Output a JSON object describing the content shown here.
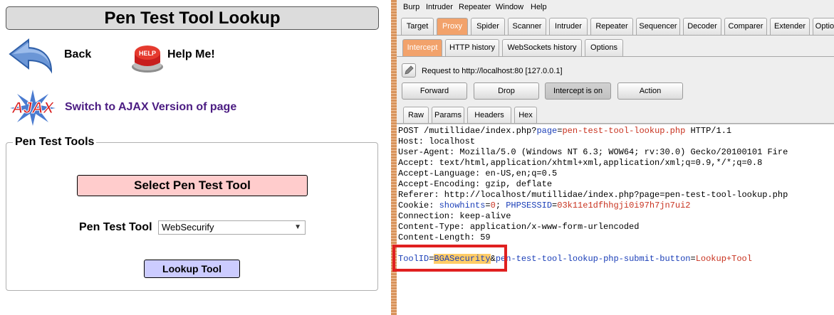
{
  "left": {
    "title": "Pen Test Tool Lookup",
    "back_label": "Back",
    "help_label": "Help Me!",
    "help_icon_text": "HELP",
    "ajax_logo_text": "AJAX",
    "ajax_link": "Switch to AJAX Version of page",
    "fieldset_legend": "Pen Test Tools",
    "select_header": "Select Pen Test Tool",
    "tool_label": "Pen Test Tool",
    "tool_selected": "WebSecurify",
    "lookup_button": "Lookup Tool"
  },
  "burp": {
    "menu": [
      "Burp",
      "Intruder",
      "Repeater",
      "Window",
      "Help"
    ],
    "main_tabs": [
      "Target",
      "Proxy",
      "Spider",
      "Scanner",
      "Intruder",
      "Repeater",
      "Sequencer",
      "Decoder",
      "Comparer",
      "Extender",
      "Option"
    ],
    "active_main_tab": "Proxy",
    "proxy_tabs": [
      "Intercept",
      "HTTP history",
      "WebSockets history",
      "Options"
    ],
    "active_proxy_tab": "Intercept",
    "request_label": "Request to http://localhost:80  [127.0.0.1]",
    "buttons": {
      "forward": "Forward",
      "drop": "Drop",
      "intercept": "Intercept is on",
      "action": "Action"
    },
    "view_tabs": [
      "Raw",
      "Params",
      "Headers",
      "Hex"
    ],
    "active_view_tab": "Raw",
    "raw": {
      "l1_a": "POST /mutillidae/index.php?",
      "l1_b": "page",
      "l1_c": "=",
      "l1_d": "pen-test-tool-lookup.php",
      "l1_e": " HTTP/1.1",
      "l2": "Host: localhost",
      "l3": "User-Agent: Mozilla/5.0 (Windows NT 6.3; WOW64; rv:30.0) Gecko/20100101 Fire",
      "l4": "Accept: text/html,application/xhtml+xml,application/xml;q=0.9,*/*;q=0.8",
      "l5": "Accept-Language: en-US,en;q=0.5",
      "l6": "Accept-Encoding: gzip, deflate",
      "l7": "Referer: http://localhost/mutillidae/index.php?page=pen-test-tool-lookup.php",
      "l8_a": "Cookie: ",
      "l8_b": "showhints",
      "l8_c": "=",
      "l8_d": "0",
      "l8_e": "; ",
      "l8_f": "PHPSESSID",
      "l8_g": "=",
      "l8_h": "03k11e1dfhhgji0i97h7jn7ui2",
      "l9": "Connection: keep-alive",
      "l10": "Content-Type: application/x-www-form-urlencoded",
      "l11": "Content-Length: 59",
      "body_a": "ToolID",
      "body_b": "=",
      "body_c": "BGASecurity",
      "body_d": "&",
      "body_e": "pen-test-tool-lookup-php-submit-button",
      "body_f": "=",
      "body_g": "Lookup+Tool"
    }
  }
}
